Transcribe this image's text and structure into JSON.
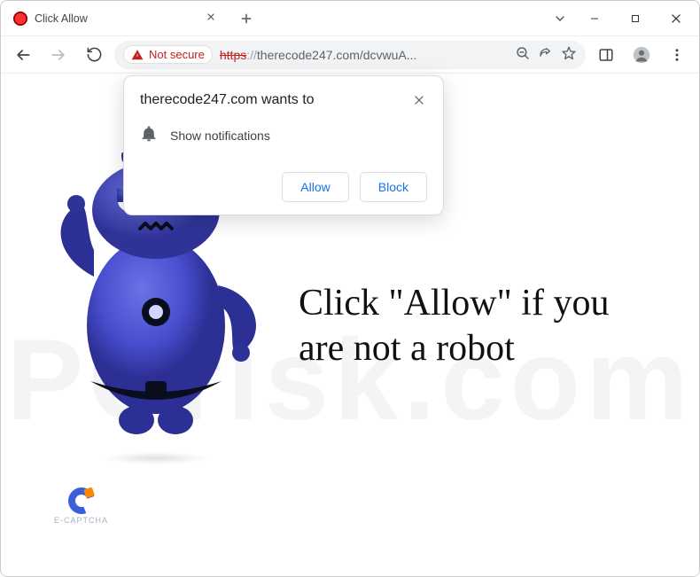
{
  "tab": {
    "title": "Click Allow"
  },
  "toolbar": {
    "not_secure_label": "Not secure",
    "url_scheme": "https",
    "url_sep": "://",
    "url_rest": "therecode247.com/dcvwuA..."
  },
  "prompt": {
    "title": "therecode247.com wants to",
    "permission_label": "Show notifications",
    "allow_label": "Allow",
    "block_label": "Block"
  },
  "page": {
    "headline": "Click \"Allow\" if you are not a robot",
    "captcha_label": "E-CAPTCHA",
    "watermark": "PCrisk.com"
  }
}
